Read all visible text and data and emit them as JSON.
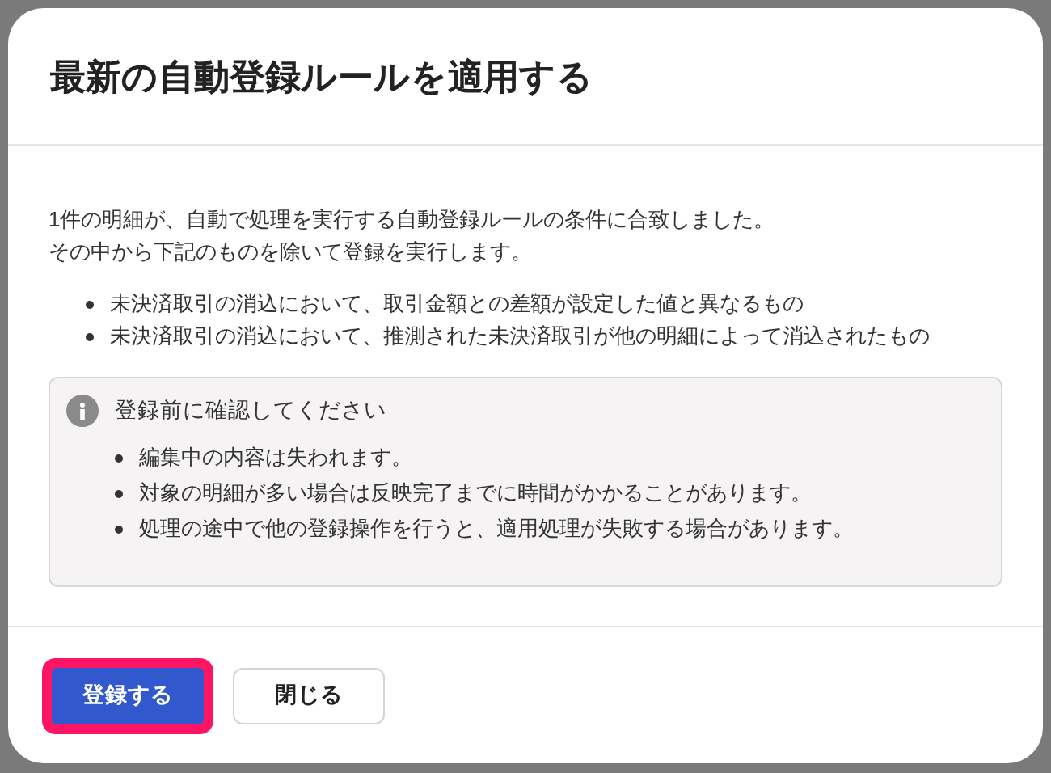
{
  "dialog": {
    "title": "最新の自動登録ルールを適用する",
    "message": [
      "1件の明細が、自動で処理を実行する自動登録ルールの条件に合致しました。",
      "その中から下記のものを除いて登録を実行します。"
    ],
    "exclusions": [
      "未決済取引の消込において、取引金額との差額が設定した値と異なるもの",
      "未決済取引の消込において、推測された未決済取引が他の明細によって消込されたもの"
    ],
    "notice": {
      "title": "登録前に確認してください",
      "items": [
        "編集中の内容は失われます。",
        "対象の明細が多い場合は反映完了までに時間がかかることがあります。",
        "処理の途中で他の登録操作を行うと、適用処理が失敗する場合があります。"
      ]
    },
    "buttons": [
      {
        "label": "登録する",
        "kind": "primary",
        "highlighted": true
      },
      {
        "label": "閉じる",
        "kind": "secondary",
        "highlighted": false
      }
    ]
  }
}
